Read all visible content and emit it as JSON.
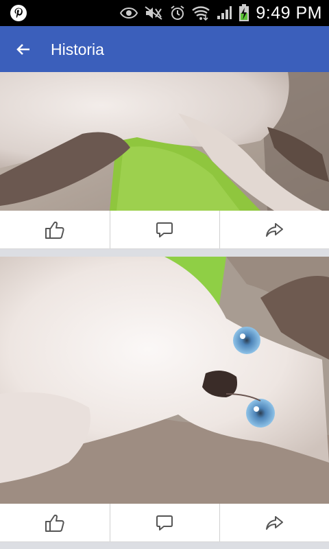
{
  "status_bar": {
    "time": "9:49 PM",
    "icons": [
      "pinterest-icon",
      "eye-icon",
      "mute-icon",
      "alarm-icon",
      "wifi-icon",
      "signal-icon",
      "battery-charging-icon"
    ]
  },
  "app_bar": {
    "title": "Historia",
    "back_icon": "arrow-back-icon"
  },
  "posts": [
    {
      "image": "kitten-photo-1",
      "actions": [
        {
          "name": "like",
          "icon": "thumbs-up-icon"
        },
        {
          "name": "comment",
          "icon": "comment-icon"
        },
        {
          "name": "share",
          "icon": "share-icon"
        }
      ]
    },
    {
      "image": "kitten-photo-2",
      "actions": [
        {
          "name": "like",
          "icon": "thumbs-up-icon"
        },
        {
          "name": "comment",
          "icon": "comment-icon"
        },
        {
          "name": "share",
          "icon": "share-icon"
        }
      ]
    }
  ],
  "colors": {
    "app_bar": "#3b5fbb",
    "status_bar": "#000000",
    "feed_background": "#dcdee3",
    "icon": "#555555"
  }
}
